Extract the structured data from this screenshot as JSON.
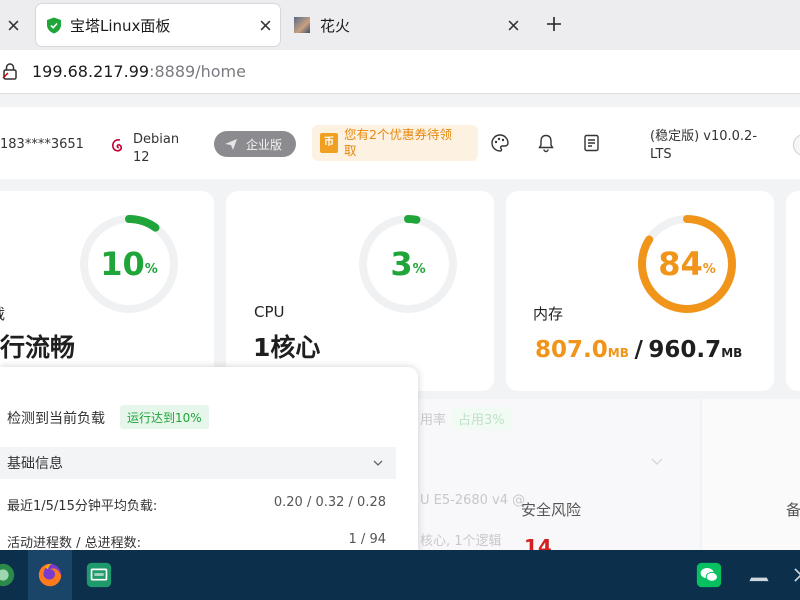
{
  "browser": {
    "tabs": [
      {
        "label": ""
      },
      {
        "label": "宝塔Linux面板"
      },
      {
        "label": "花火"
      }
    ],
    "new_tab_label": "+",
    "address": {
      "host": "199.68.217.99",
      "rest": ":8889/home"
    }
  },
  "header": {
    "phone": "183****3651",
    "os_name": "Debian",
    "os_version": "12",
    "upgrade_label": "企业版",
    "coupon_line1": "您有2个优惠券待领",
    "coupon_line2": "取",
    "coupon_badge": "币",
    "version_line1": "(稳定版) v10.0.2-",
    "version_line2": "LTS"
  },
  "cards": {
    "load": {
      "title_partial": "载",
      "status": "行流畅",
      "percent": 10,
      "percent_label": "10",
      "unit": "%"
    },
    "cpu": {
      "title": "CPU",
      "cores": "1核心",
      "percent": 3,
      "percent_label": "3",
      "unit": "%"
    },
    "memory": {
      "title": "内存",
      "percent": 84,
      "percent_label": "84",
      "unit": "%",
      "used": "807.0",
      "used_unit": "MB",
      "separator": "/",
      "total": "960.7",
      "total_unit": "MB"
    }
  },
  "background": {
    "faded1": "用率",
    "faded2": "占用3%",
    "faded3": "U E5-2680 v4 @",
    "faded4": "核心, 1个逻辑",
    "security_label": "安全风险",
    "security_count": "14",
    "side_label": "备"
  },
  "popup": {
    "detect_label": "检测到当前负载",
    "status_tag": "运行达到10%",
    "section_label": "基础信息",
    "row1_label": "最近1/5/15分钟平均负载:",
    "row1_value": "0.20 / 0.32 / 0.28",
    "row2_label": "活动进程数 / 总进程数:",
    "row2_value": "1 / 94"
  },
  "colors": {
    "green": "#20a53a",
    "orange": "#f0941a",
    "track": "#f0f1f3",
    "taskbar": "#0c2f4c"
  },
  "taskbar": {
    "icons": [
      "linux-mint-menu-icon",
      "firefox-icon",
      "remote-desktop-icon",
      "wechat-icon",
      "tray-network-icon"
    ]
  }
}
